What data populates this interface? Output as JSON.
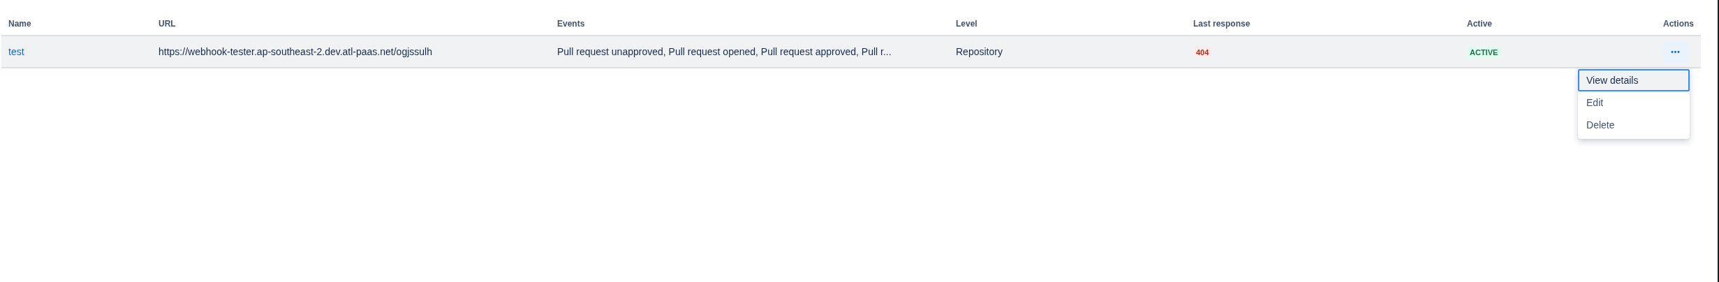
{
  "table": {
    "columns": [
      "Name",
      "URL",
      "Events",
      "Level",
      "Last response",
      "Active",
      "Actions"
    ],
    "rows": [
      {
        "name": "test",
        "url": "https://webhook-tester.ap-southeast-2.dev.atl-paas.net/ogjssulh",
        "events": "Pull request unapproved, Pull request opened, Pull request approved, Pull r...",
        "level": "Repository",
        "last_response": "404",
        "active": "ACTIVE",
        "actions_button": "•••",
        "selected": true
      }
    ]
  },
  "actions_menu": {
    "items": [
      {
        "label": "View details",
        "selected": true
      },
      {
        "label": "Edit",
        "selected": false
      },
      {
        "label": "Delete",
        "selected": false
      }
    ]
  }
}
